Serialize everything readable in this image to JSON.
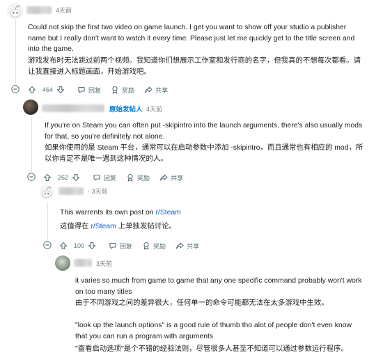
{
  "comments": [
    {
      "timestamp": "4天前",
      "body_en": "Could not skip the first two video on game launch. I get you want to show off your studio a publisher name but I really don't want to watch it every time. Please just let me quickly get to the title screen and into the game.",
      "body_zh": "游戏发布时无法跳过前两个视频。我知道你们想展示工作室和发行商的名字，但我真的不想每次都看。请让我直接进入标题画面，开始游戏吧。",
      "votes": "464",
      "reply_label": "回复",
      "award_label": "奖励",
      "share_label": "共享"
    },
    {
      "op_tag": "原始发帖人",
      "timestamp": "4天前",
      "body_en": "If you're on Steam you can often put -skipintro into the launch arguments, there's also usually mods for that, so you're definitely not alone.",
      "body_zh": "如果你使用的是 Steam 平台，通常可以在启动参数中添加 -skipintro，而且通常也有相应的 mod，所以你肯定不是唯一遇到这种情况的人。",
      "votes": "262",
      "reply_label": "回复",
      "award_label": "奖励",
      "share_label": "共享"
    },
    {
      "timestamp": "3天前",
      "body_en_prefix": "This warrents its own post on ",
      "body_en_link": "r/Steam",
      "body_zh_prefix": "这值得在 ",
      "body_zh_link": "r/Steam",
      "body_zh_suffix": " 上单独发帖讨论。",
      "votes": "100",
      "reply_label": "回复",
      "award_label": "奖励",
      "share_label": "共享"
    },
    {
      "timestamp": "3天前",
      "body_en_1": "it varies so much from game to game that any one specific command probably won't work on too many titles",
      "body_zh_1": "由于不同游戏之间的差异很大，任何单一的命令可能都无法在太多游戏中生效。",
      "body_en_2": "\"look up the launch options\" is a good rule of thumb tho alot of people don't even know that you can run a program with arguments",
      "body_zh_2": "\"查看启动选项\"是个不错的经验法则，尽管很多人甚至不知道可以通过参数运行程序。"
    }
  ],
  "colors": {
    "link": "#0a5bd6",
    "op": "#0079d3",
    "meta": "#7c7c7c",
    "actions": "#576f76"
  },
  "icons": [
    "avatar",
    "collapse-icon",
    "upvote-icon",
    "downvote-icon",
    "reply-icon",
    "award-icon",
    "share-icon"
  ]
}
